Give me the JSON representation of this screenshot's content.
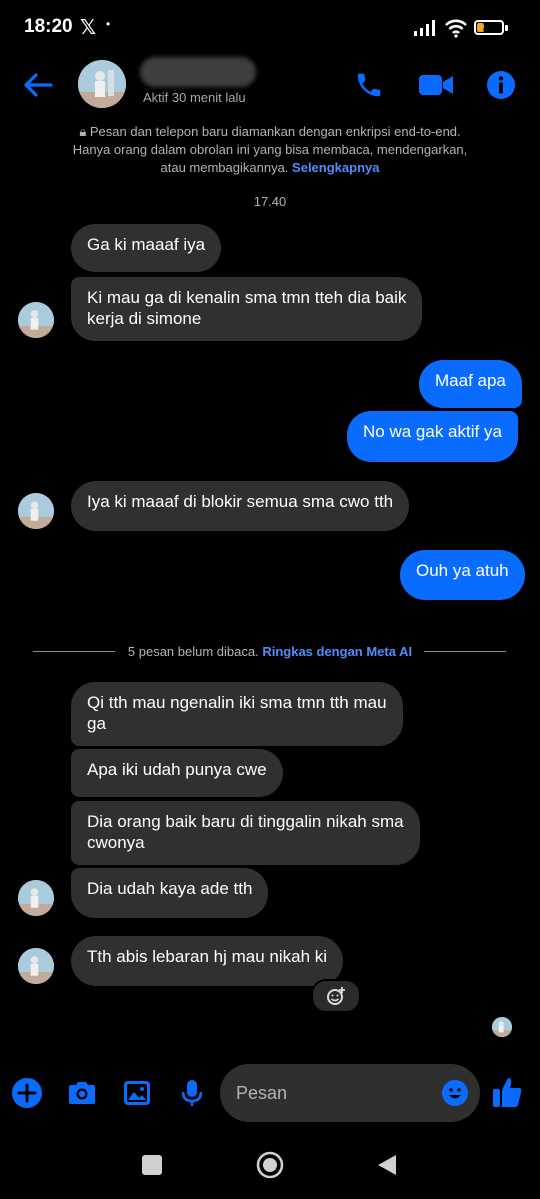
{
  "status_bar": {
    "time": "18:20",
    "x_logo": "𝕏",
    "dot": "•",
    "battery": "28"
  },
  "header": {
    "last_active": "Aktif 30 menit lalu",
    "back_icon": "arrow-left-icon",
    "call_icon": "phone-icon",
    "video_icon": "video-camera-icon",
    "info_icon": "info-icon"
  },
  "encryption": {
    "text": "Pesan dan telepon baru diamankan dengan enkripsi end-to-end. Hanya orang dalam obrolan ini yang bisa membaca, mendengarkan, atau membagikannya.",
    "link": "Selengkapnya"
  },
  "timestamp": "17.40",
  "messages": [
    {
      "from": "them",
      "text": "Ga ki maaaf iya"
    },
    {
      "from": "them",
      "text": "Ki mau ga di kenalin sma tmn tteh dia baik\nkerja di simone"
    },
    {
      "from": "me",
      "text": "Maaf apa"
    },
    {
      "from": "me",
      "text": "No wa gak aktif ya"
    },
    {
      "from": "them",
      "text": "Iya ki maaaf di blokir semua sma cwo tth"
    },
    {
      "from": "me",
      "text": "Ouh ya atuh"
    },
    {
      "from": "them",
      "text": "Qi tth mau ngenalin iki sma tmn tth mau\nga"
    },
    {
      "from": "them",
      "text": "Apa iki udah punya cwe"
    },
    {
      "from": "them",
      "text": "Dia orang baik baru di tinggalin nikah sma\ncwonya"
    },
    {
      "from": "them",
      "text": "Dia udah kaya ade tth"
    },
    {
      "from": "them",
      "text": "Tth abis lebaran hj mau nikah ki"
    }
  ],
  "unread": {
    "text": "5 pesan belum dibaca.",
    "link": "Ringkas dengan Meta AI"
  },
  "composer": {
    "placeholder": "Pesan"
  },
  "colors": {
    "accent": "#0a6cff",
    "received_bubble": "#303030",
    "background": "#000000",
    "link": "#4f8dff"
  }
}
